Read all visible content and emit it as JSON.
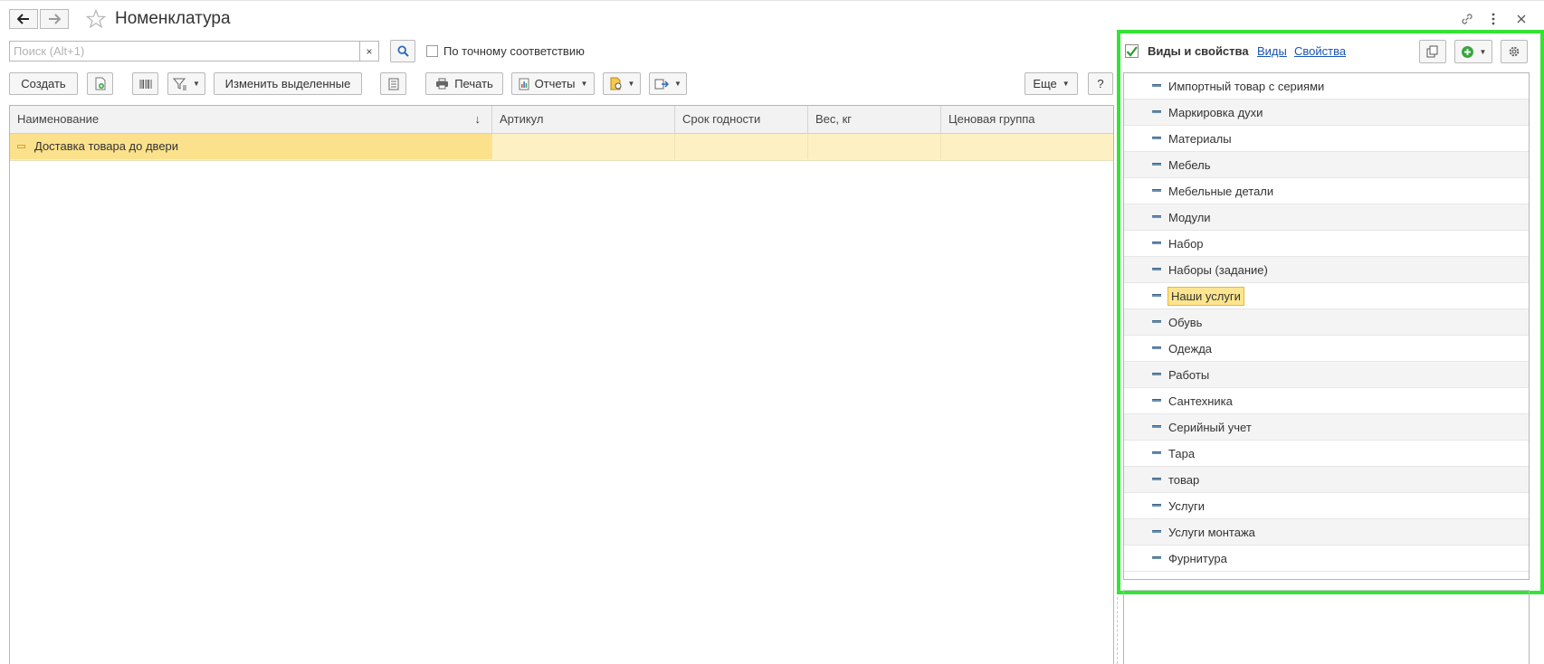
{
  "window": {
    "title": "Номенклатура",
    "icons": [
      "back-arrow-icon",
      "forward-arrow-icon",
      "star-icon",
      "link-icon",
      "more-vertical-icon",
      "close-icon"
    ]
  },
  "search": {
    "placeholder": "Поиск (Alt+1)",
    "value": "",
    "clear_label": "×",
    "exact_match_label": "По точному соответствию"
  },
  "toolbar": {
    "create_label": "Создать",
    "edit_selected_label": "Изменить выделенные",
    "print_label": "Печать",
    "reports_label": "Отчеты",
    "more_label": "Еще",
    "help_label": "?"
  },
  "grid": {
    "columns": [
      "Наименование",
      "Артикул",
      "Срок годности",
      "Вес, кг",
      "Ценовая группа"
    ],
    "sort_indicator": "↓",
    "rows": [
      {
        "name": "Доставка товара до двери",
        "article": "",
        "shelf_life": "",
        "weight": "",
        "price_group": ""
      }
    ]
  },
  "right_panel": {
    "title": "Виды и свойства",
    "checked": true,
    "link_types": "Виды",
    "link_properties": "Свойства",
    "selected_item": "Наши услуги",
    "items": [
      "Импортный товар с сериями",
      "Маркировка духи",
      "Материалы",
      "Мебель",
      "Мебельные детали",
      "Модули",
      "Набор",
      "Наборы (задание)",
      "Наши услуги",
      "Обувь",
      "Одежда",
      "Работы",
      "Сантехника",
      "Серийный учет",
      "Тара",
      "товар",
      "Услуги",
      "Услуги монтажа",
      "Фурнитура"
    ]
  },
  "colors": {
    "highlight_frame": "#34e334",
    "selected_row": "#fdf1c4",
    "selected_cell": "#fbe18b",
    "link": "#1b55b5"
  }
}
